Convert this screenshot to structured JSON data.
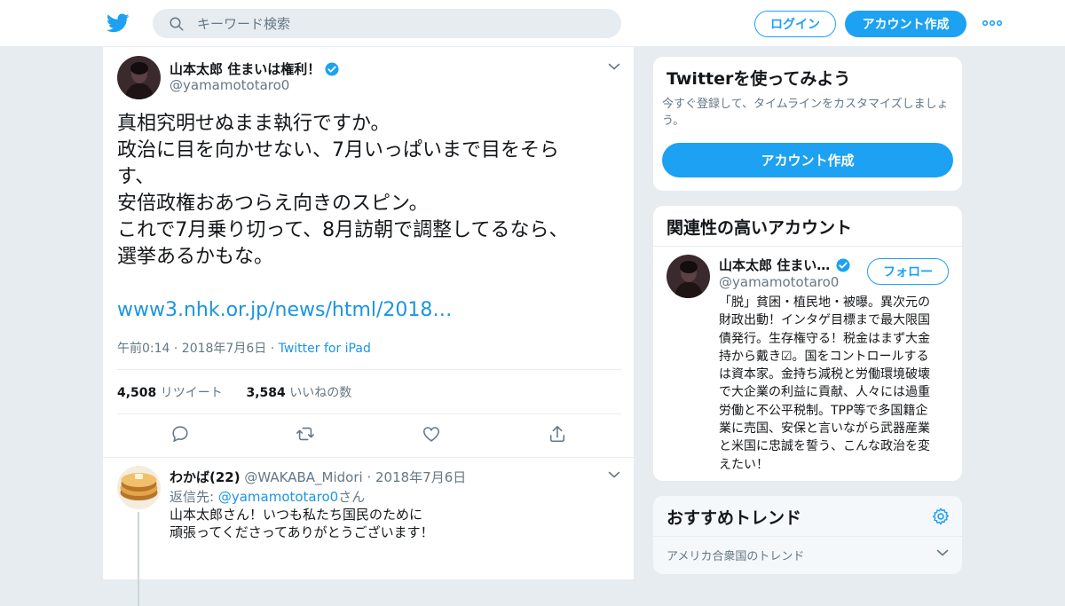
{
  "header": {
    "search_placeholder": "キーワード検索",
    "login_label": "ログイン",
    "signup_label": "アカウント作成"
  },
  "tweet": {
    "author_name": "山本太郎 住まいは権利！",
    "author_handle": "@yamamototaro0",
    "text_lines": [
      "真相究明せぬまま執行ですか。",
      "政治に目を向かせない、7月いっぱいまで目をそら",
      "す、",
      "安倍政権おあつらえ向きのスピン。",
      "これで7月乗り切って、8月訪朝で調整してるなら、",
      "選挙あるかもな。"
    ],
    "link_text": "www3.nhk.or.jp/news/html/2018…",
    "timestamp": "午前0:14 · 2018年7月6日",
    "dot_separator": "·",
    "source": "Twitter for iPad",
    "retweet_count": "4,508",
    "retweet_label": "リツイート",
    "like_count": "3,584",
    "like_label": "いいねの数"
  },
  "reply": {
    "author_name": "わかば(22)",
    "author_handle": "@WAKABA_Midori",
    "date": "· 2018年7月6日",
    "reply_to_prefix": "返信先: ",
    "reply_to_handle": "@yamamototaro0",
    "reply_to_suffix": "さん",
    "text_lines": [
      "山本太郎さん！いつも私たち国民のために",
      "頑張ってくださってありがとうございます！"
    ]
  },
  "sidebar": {
    "signup_card": {
      "title": "Twitterを使ってみよう",
      "desc_lines": [
        "今すぐ登録して、タイムラインをカスタマイズしましょ",
        "う。"
      ],
      "button_label": "アカウント作成"
    },
    "related_card": {
      "title": "関連性の高いアカウント",
      "name": "山本太郎 住まい…",
      "handle": "@yamamototaro0",
      "follow_label": "フォロー",
      "bio_lines": [
        "「脱」貧困・植民地・被曝。異次元の",
        "財政出動！インタゲ目標まで最大限国",
        "債発行。生存権守る！税金はまず大金",
        "持から戴き☑。国をコントロールする",
        "は資本家。金持ち減税と労働環境破壊",
        "で大企業の利益に貢献、人々には過重",
        "労働と不公平税制。TPP等で多国籍企",
        "業に売国、安保と言いながら武器産業",
        "と米国に忠誠を誓う、こんな政治を変",
        "えたい！"
      ]
    },
    "trends_card": {
      "title": "おすすめトレンド",
      "location_label": "アメリカ合衆国のトレンド"
    }
  },
  "colors": {
    "brand": "#1da1f2",
    "link": "#1b95e0",
    "muted": "#657786",
    "background": "#e6ecf0"
  },
  "icons": [
    "twitter-logo-icon",
    "search-icon",
    "more-icon",
    "verified-icon",
    "chevron-down-icon",
    "reply-icon",
    "retweet-icon",
    "like-icon",
    "share-icon",
    "settings-icon"
  ]
}
